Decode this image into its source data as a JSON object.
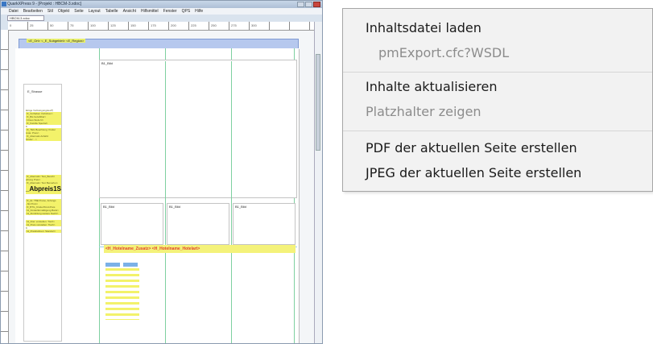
{
  "qx_window": {
    "title": "QuarkXPress 9 - [Projekt : HBCM-3.xdoc]",
    "menu": [
      "Datei",
      "Bearbeiten",
      "Stil",
      "Objekt",
      "Seite",
      "Layout",
      "Tabelle",
      "Ansicht",
      "Hilfsmittel",
      "Fenster",
      "QPS",
      "Hilfe"
    ],
    "doc_tab": "HBCM-3.xdoc",
    "ruler_numbers": [
      "0",
      "25",
      "50",
      "75",
      "100",
      "125",
      "150",
      "175",
      "200",
      "225",
      "250",
      "275",
      "300"
    ],
    "header_tags": "<E_Ort> <_E_Subgebiet> <E_Region>",
    "sidebar": {
      "strasse": "E_Strasse",
      "text_lines": [
        "Einige Vorl/eingungstext¶",
        "<F_Vorhaben Vorfahren>",
        "<F_Bis bezahlbar>",
        "<Ursus Stufe N>",
        "<F_Familie Spezial>",
        "K",
        "<F_TEIL Beachtung: Kinder",
        "Liste: Preis>",
        "<F_Alternativ Anfahrt",
        "Kinder: ..>"
      ],
      "text_lines2": [
        "<F_Alternativ: Text_Beschr",
        "eibung Preis>",
        "<F_Alternativ: Text Bemerkun",
        "g Preis>"
      ],
      "abpreis": "_Abpreis1S",
      "text_lines3": [
        "<F_kk. TBE Preise, Anfangs",
        "- bis Preis>",
        "<F_BTG_Kinder/Kind-Preis",
        "<H_Kinder/Ermäßigung Bank>",
        "<H_Zuzahlung weitere Nacht>"
      ],
      "text_lines4": [
        "<H_Drei: vorstellen: Tisch>",
        "<H_Preis vorstellen: Tisch>",
        "K",
        "<H_Preisbahnen: Standort>"
      ]
    },
    "frames": {
      "bild_top": "B1_Bild",
      "bild_1": "B1_Bild",
      "bild_2": "B1_Bild",
      "bild_3": "B1_Bild"
    },
    "hotel_line": "<H_Hotelname_Zusatz> <H_Hotelname_Hotelart>"
  },
  "context_menu": {
    "items": [
      {
        "label": "Inhaltsdatei laden",
        "enabled": true
      },
      {
        "label": "pmExport.cfc?WSDL",
        "enabled": false
      },
      {
        "label": "Inhalte aktualisieren",
        "enabled": true
      },
      {
        "label": "Platzhalter zeigen",
        "enabled": false
      },
      {
        "label": "PDF der aktuellen Seite erstellen",
        "enabled": true
      },
      {
        "label": "JPEG der aktuellen Seite erstellen",
        "enabled": true
      }
    ]
  },
  "colors": {
    "menu_bg": "#f2f2f2",
    "disabled_text": "#8c8c8c",
    "placeholder_yellow": "#f3f26a",
    "header_blue": "#b6c8ee",
    "hotel_red": "#e2402b"
  }
}
